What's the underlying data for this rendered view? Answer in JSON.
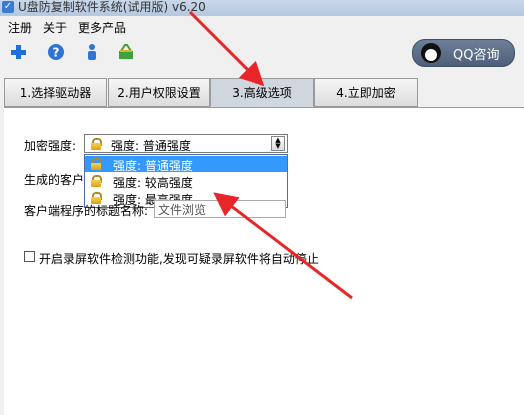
{
  "window": {
    "title": "U盘防复制软件系统(试用版) v6.20"
  },
  "menu": {
    "items": [
      "注册",
      "关于",
      "更多产品"
    ]
  },
  "toolbar": {
    "icons": [
      "plus-icon",
      "help-icon",
      "user-icon",
      "basket-icon"
    ]
  },
  "qq_button": {
    "label": "QQ咨询"
  },
  "tabs": [
    {
      "label": "1.选择驱动器"
    },
    {
      "label": "2.用户权限设置"
    },
    {
      "label": "3.高级选项"
    },
    {
      "label": "4.立即加密"
    }
  ],
  "advanced": {
    "encryption_label": "加密强度:",
    "encryption_value": "强度: 普通强度",
    "encryption_options": [
      "强度: 普通强度",
      "强度: 较高强度",
      "强度: 最高强度"
    ],
    "client_label": "生成的客户",
    "title_label": "客户端程序的标题名称:",
    "title_value": "文件浏览",
    "screen_detect_label": "开启录屏软件检测功能,发现可疑录屏软件将自动停止"
  },
  "colors": {
    "selection": "#3399ff",
    "arrow": "#e8262a"
  }
}
